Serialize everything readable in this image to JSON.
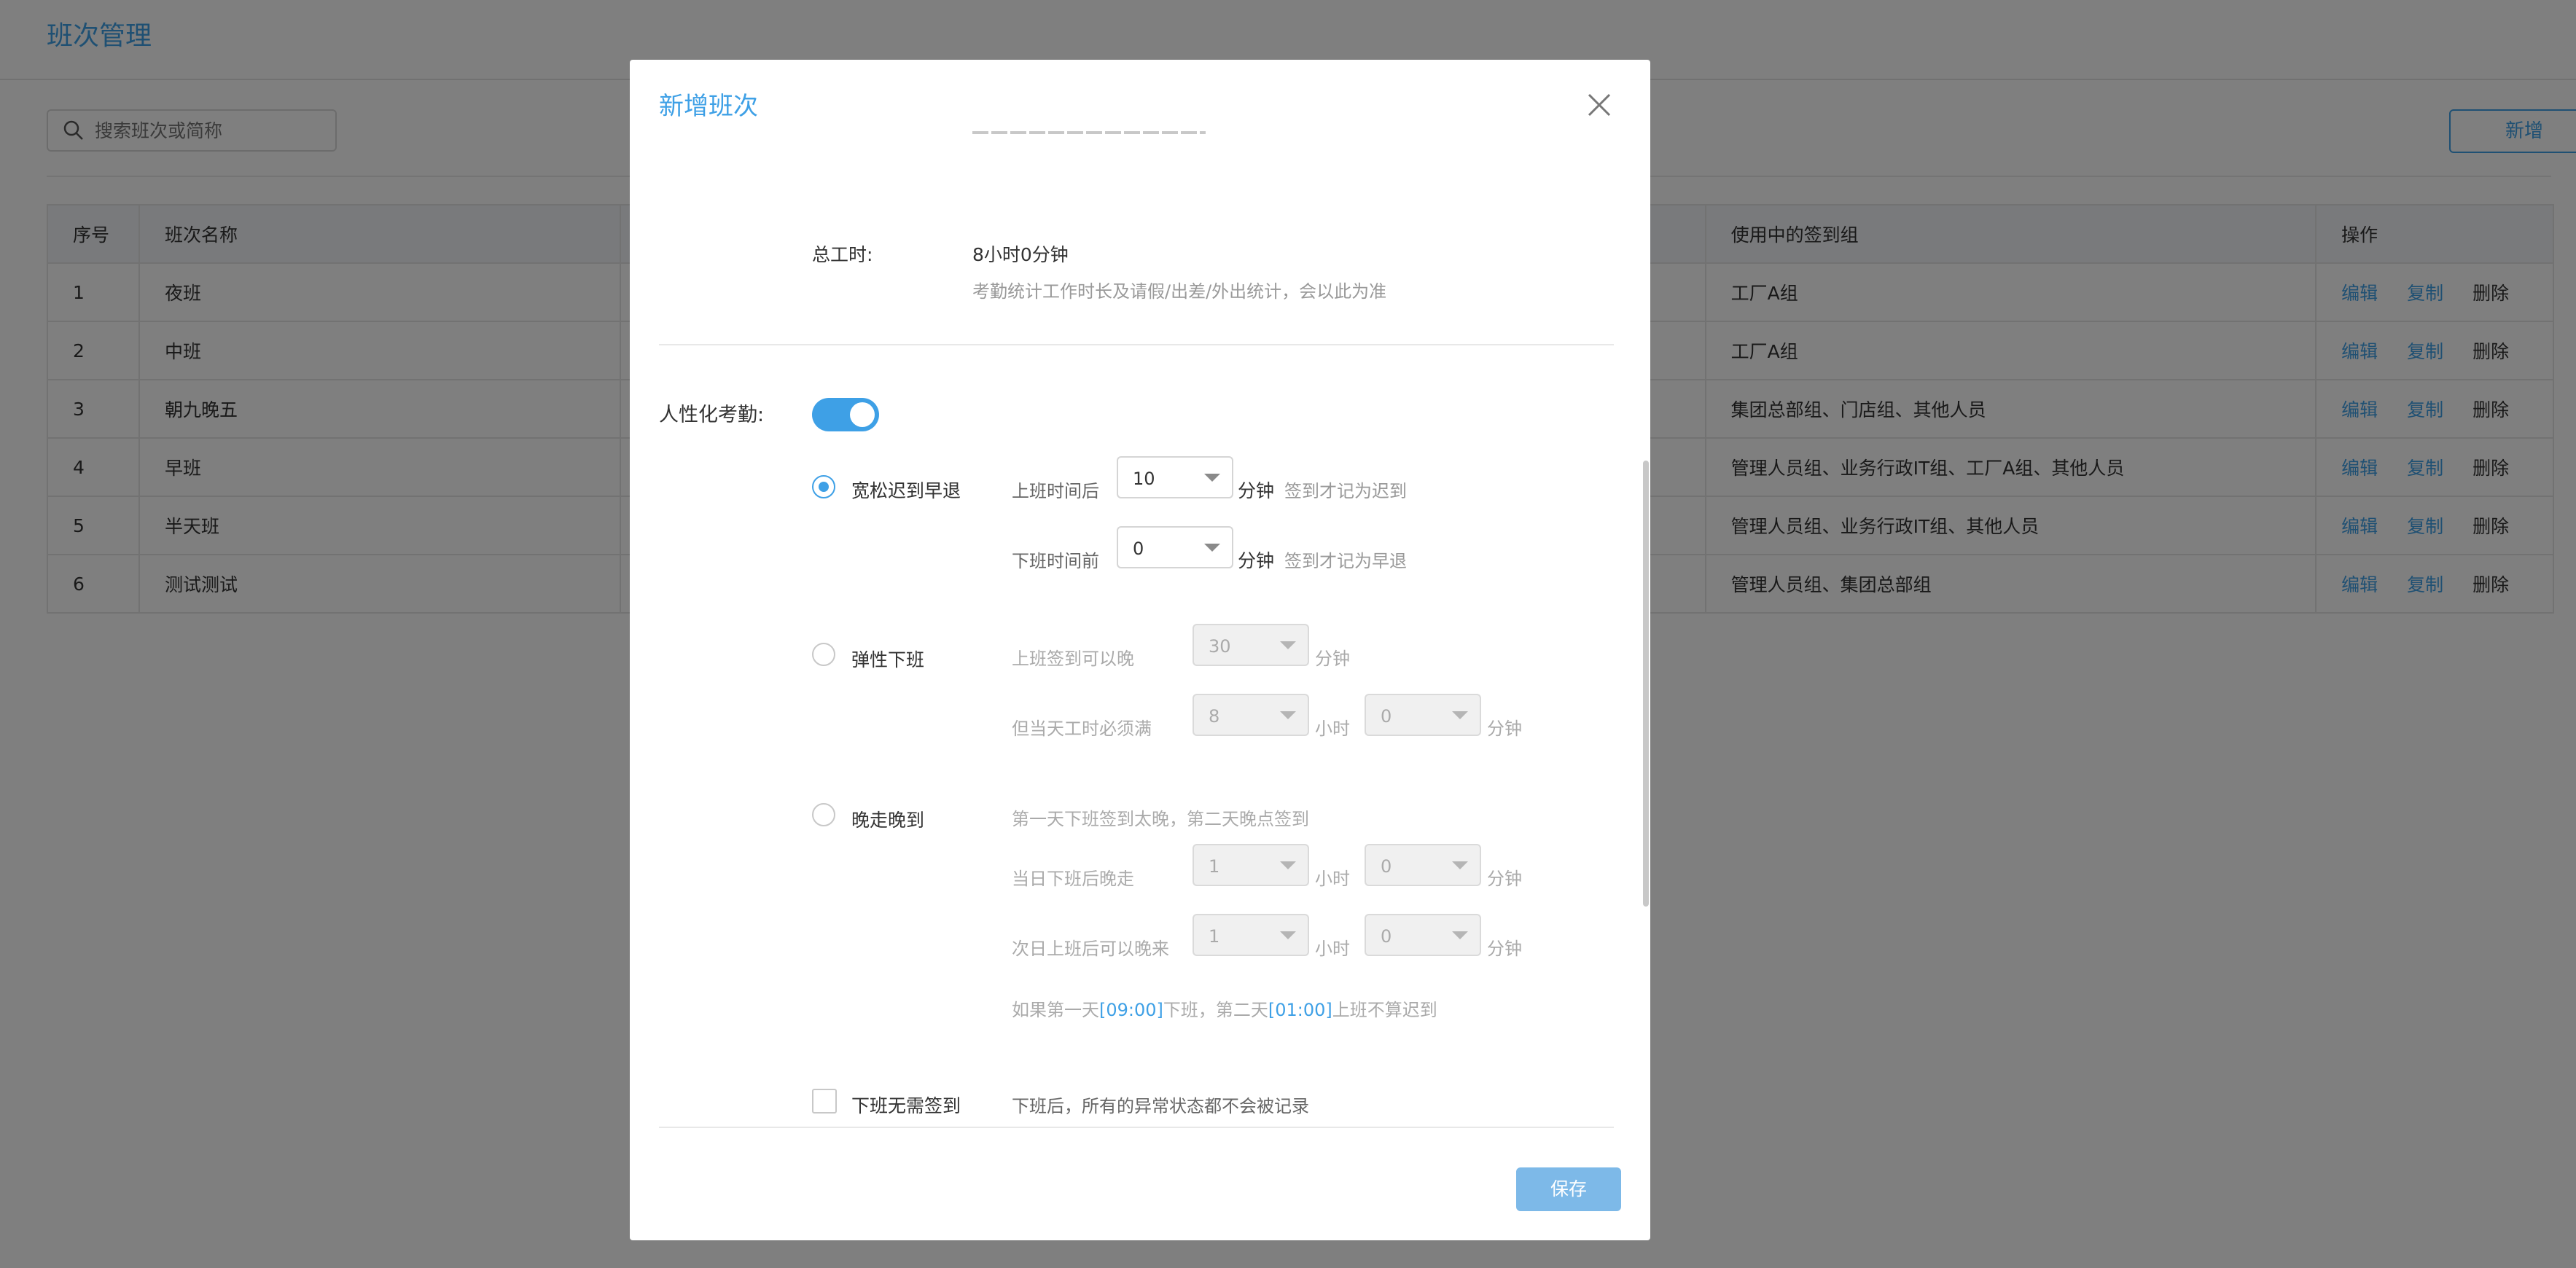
{
  "page": {
    "title": "班次管理"
  },
  "search": {
    "placeholder": "搜索班次或简称"
  },
  "toolbar": {
    "new_label": "新增"
  },
  "table": {
    "headers": {
      "index": "序号",
      "name": "班次名称",
      "groups": "使用中的签到组",
      "ops": "操作"
    },
    "rows": [
      {
        "index": "1",
        "name": "夜班",
        "groups": "工厂A组"
      },
      {
        "index": "2",
        "name": "中班",
        "groups": "工厂A组"
      },
      {
        "index": "3",
        "name": "朝九晚五",
        "groups": "集团总部组、门店组、其他人员"
      },
      {
        "index": "4",
        "name": "早班",
        "groups": "管理人员组、业务行政IT组、工厂A组、其他人员"
      },
      {
        "index": "5",
        "name": "半天班",
        "groups": "管理人员组、业务行政IT组、其他人员"
      },
      {
        "index": "6",
        "name": "测试测试",
        "groups": "管理人员组、集团总部组"
      }
    ],
    "actions": {
      "edit": "编辑",
      "copy": "复制",
      "delete": "删除"
    }
  },
  "modal": {
    "title": "新增班次",
    "total_hours": {
      "label": "总工时:",
      "value": "8小时0分钟",
      "note": "考勤统计工作时长及请假/出差/外出统计，会以此为准"
    },
    "humanized": {
      "label": "人性化考勤:",
      "enabled": true
    },
    "lenient": {
      "label": "宽松迟到早退",
      "selected": true,
      "after_start_label": "上班时间后",
      "after_start_value": "10",
      "after_start_suffix": "签到才记为迟到",
      "before_end_label": "下班时间前",
      "before_end_value": "0",
      "before_end_suffix": "签到才记为早退"
    },
    "flexible": {
      "label": "弹性下班",
      "selected": false,
      "late_label": "上班签到可以晚",
      "late_value": "30",
      "must_label": "但当天工时必须满",
      "must_hours": "8",
      "must_minutes": "0"
    },
    "late_leave": {
      "label": "晚走晚到",
      "selected": false,
      "desc": "第一天下班签到太晚，第二天晚点签到",
      "leave_label": "当日下班后晚走",
      "leave_hours": "1",
      "leave_minutes": "0",
      "arrive_label": "次日上班后可以晚来",
      "arrive_hours": "1",
      "arrive_minutes": "0",
      "example_prefix": "如果第一天",
      "example_time1": "[09:00]",
      "example_mid": "下班，第二天",
      "example_time2": "[01:00]",
      "example_suffix": "上班不算迟到"
    },
    "no_checkout": {
      "label": "下班无需签到",
      "checked": false,
      "desc": "下班后，所有的异常状态都不会被记录"
    },
    "units": {
      "minute": "分钟",
      "hour": "小时"
    },
    "save_label": "保存"
  },
  "colors": {
    "accent": "#3ea0e6",
    "save_button": "#7db9e8",
    "overlay": "rgba(0,0,0,0.5)"
  }
}
